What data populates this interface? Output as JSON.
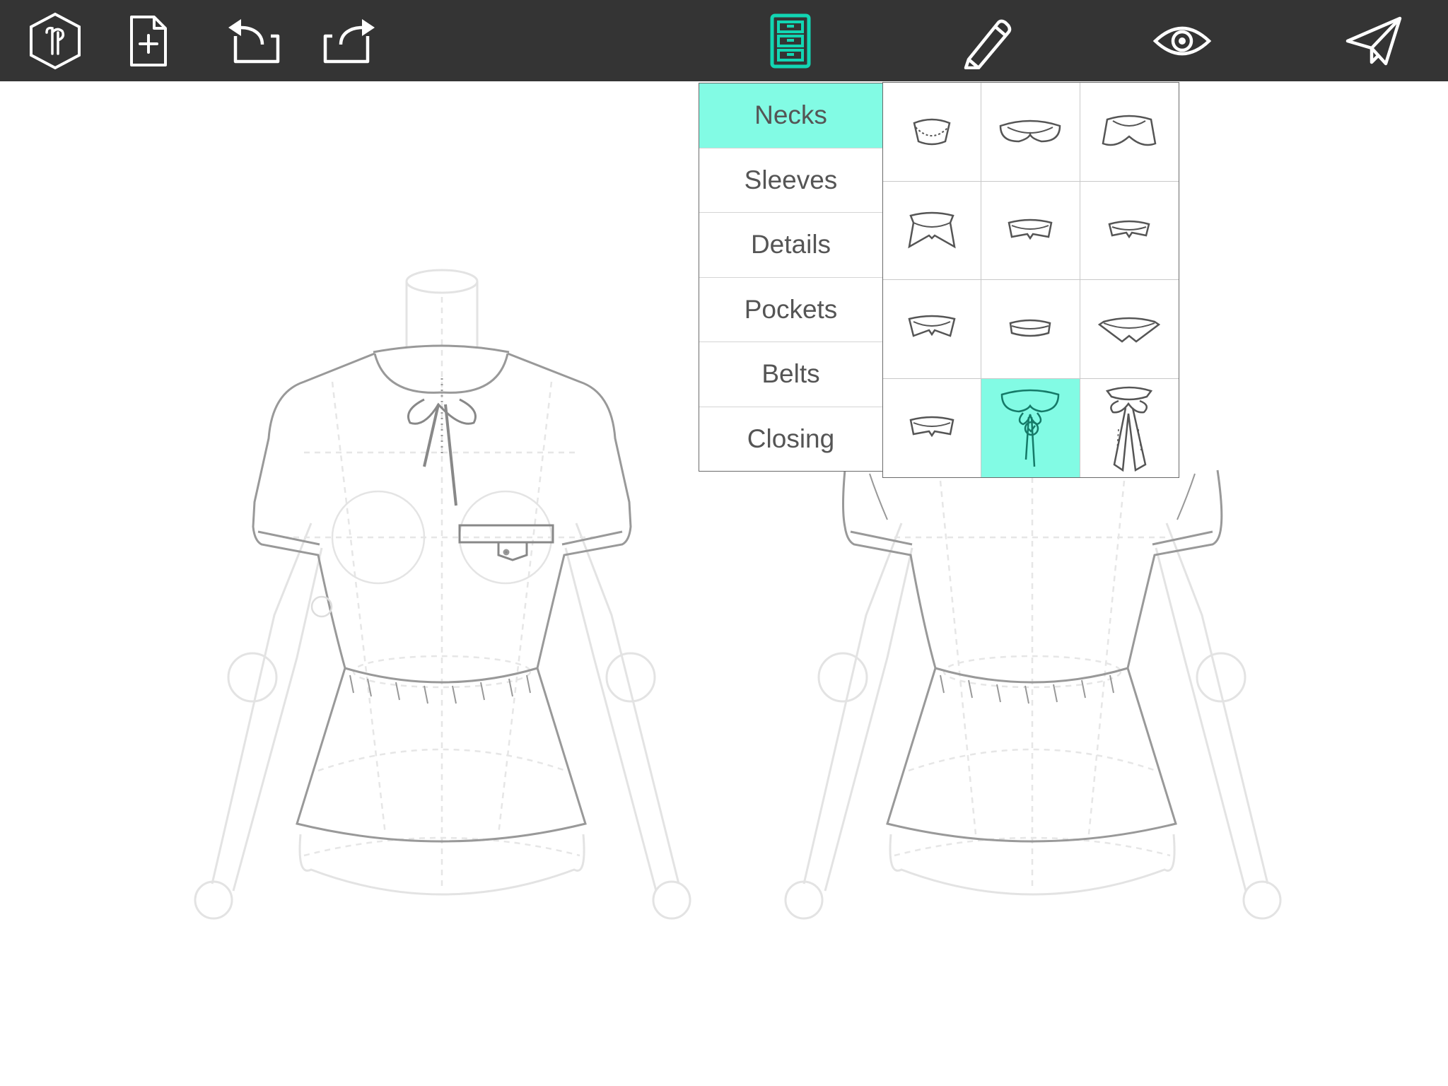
{
  "toolbar": {
    "buttons": [
      {
        "name": "app-logo",
        "icon": "hexagon-logo-icon"
      },
      {
        "name": "new-document",
        "icon": "document-plus-icon"
      },
      {
        "name": "undo",
        "icon": "undo-arrow-icon"
      },
      {
        "name": "redo",
        "icon": "redo-arrow-icon"
      },
      {
        "name": "library",
        "icon": "drawers-icon",
        "active": true
      },
      {
        "name": "draw",
        "icon": "pencil-icon"
      },
      {
        "name": "preview",
        "icon": "eye-icon"
      },
      {
        "name": "send",
        "icon": "paper-plane-icon"
      }
    ]
  },
  "categories": {
    "items": [
      "Necks",
      "Sleeves",
      "Details",
      "Pockets",
      "Belts",
      "Closing"
    ],
    "selected": "Necks"
  },
  "necks": {
    "selected_index": 10,
    "options": [
      "neckline-icon",
      "peter-pan-collar-icon",
      "rounded-collar-icon",
      "pointed-collar-icon",
      "shirt-collar-icon",
      "shirt-collar-icon",
      "spread-collar-icon",
      "band-collar-icon",
      "wide-pointed-collar-icon",
      "classic-collar-icon",
      "peter-pan-bow-collar-icon",
      "pussy-bow-collar-icon"
    ]
  },
  "colors": {
    "toolbar_bg": "#343434",
    "accent": "#82fbe4",
    "accent_stroke": "#12d6b3",
    "garment_line": "#8a8a8a",
    "mannequin_line": "#e0e0e0"
  }
}
